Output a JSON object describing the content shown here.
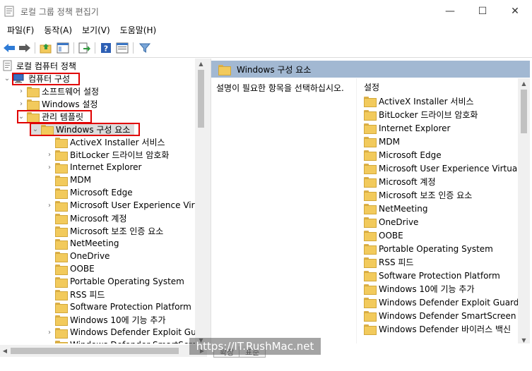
{
  "window": {
    "title": "로컬 그룹 정책 편집기",
    "min_glyph": "—",
    "max_glyph": "☐",
    "close_glyph": "✕"
  },
  "menu": {
    "items": [
      "파일(F)",
      "동작(A)",
      "보기(V)",
      "도움말(H)"
    ]
  },
  "toolbar": {
    "icons": [
      "back-arrow-icon",
      "forward-arrow-icon",
      "up-folder-icon",
      "show-hide-tree-icon",
      "export-list-icon",
      "help-icon",
      "properties-icon",
      "filter-icon"
    ]
  },
  "tree": {
    "root": "로컬 컴퓨터 정책",
    "computer_config": "컴퓨터 구성",
    "software_settings": "소프트웨어 설정",
    "windows_settings": "Windows 설정",
    "admin_templates": "관리 템플릿",
    "windows_components": "Windows 구성 요소",
    "children": [
      {
        "label": "ActiveX Installer 서비스",
        "expandable": false
      },
      {
        "label": "BitLocker 드라이브 암호화",
        "expandable": true
      },
      {
        "label": "Internet Explorer",
        "expandable": true
      },
      {
        "label": "MDM",
        "expandable": false
      },
      {
        "label": "Microsoft Edge",
        "expandable": false
      },
      {
        "label": "Microsoft User Experience Virtua",
        "expandable": true
      },
      {
        "label": "Microsoft 계정",
        "expandable": false
      },
      {
        "label": "Microsoft 보조 인증 요소",
        "expandable": false
      },
      {
        "label": "NetMeeting",
        "expandable": false
      },
      {
        "label": "OneDrive",
        "expandable": false
      },
      {
        "label": "OOBE",
        "expandable": false
      },
      {
        "label": "Portable Operating System",
        "expandable": false
      },
      {
        "label": "RSS 피드",
        "expandable": false
      },
      {
        "label": "Software Protection Platform",
        "expandable": false
      },
      {
        "label": "Windows 10에 기능 추가",
        "expandable": false
      },
      {
        "label": "Windows Defender Exploit Guard",
        "expandable": true
      },
      {
        "label": "Windows Defender SmartScreen",
        "expandable": true
      }
    ]
  },
  "right": {
    "header": "Windows 구성 요소",
    "description": "설명이 필요한 항목을 선택하십시오.",
    "column": "설정",
    "items": [
      "ActiveX Installer 서비스",
      "BitLocker 드라이브 암호화",
      "Internet Explorer",
      "MDM",
      "Microsoft Edge",
      "Microsoft User Experience Virtualizati",
      "Microsoft 계정",
      "Microsoft 보조 인증 요소",
      "NetMeeting",
      "OneDrive",
      "OOBE",
      "Portable Operating System",
      "RSS 피드",
      "Software Protection Platform",
      "Windows 10에 기능 추가",
      "Windows Defender Exploit Guard",
      "Windows Defender SmartScreen",
      "Windows Defender 바이러스 백신"
    ]
  },
  "tabs": [
    "확장",
    "표준"
  ],
  "watermark": "https://IT.RushMac.net",
  "colors": {
    "header_bar": "#a2b8d2",
    "highlight_box": "#e00000",
    "folder": "#f2ca5c"
  }
}
